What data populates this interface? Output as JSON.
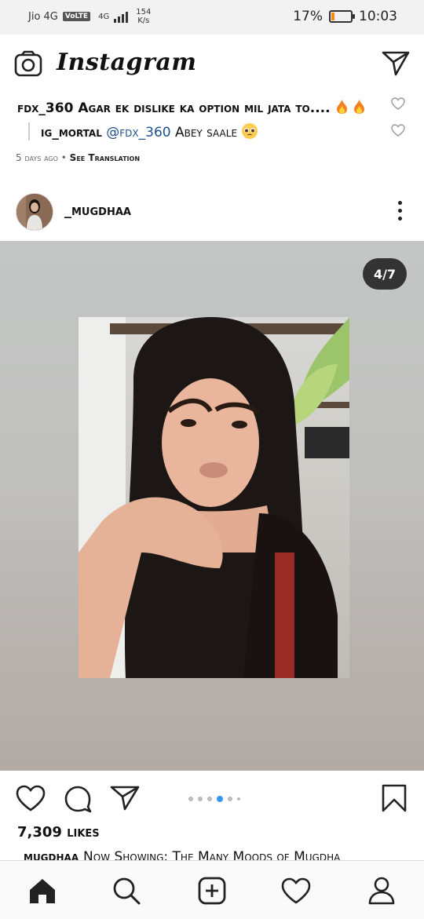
{
  "status_bar": {
    "carrier": "Jio 4G",
    "volte": "VoLTE",
    "network_type": "4G",
    "speed_value": "154",
    "speed_unit": "K/s",
    "battery_percent": "17%",
    "battery_level": 0.17,
    "battery_color": "#f28c16",
    "time": "10:03"
  },
  "app_bar": {
    "title": "Instagram",
    "left_icon": "camera-icon",
    "right_icon": "direct-send-icon"
  },
  "comments": [
    {
      "username": "fdx_360",
      "text": "Agar ek dislike ka option mil jata to....",
      "emoji": "fire fire"
    },
    {
      "username": "ig_mortal",
      "mention": "@fdx_360",
      "text": "Abey saale",
      "emoji": "pleading-face"
    }
  ],
  "comment_meta": {
    "time_ago": "5 days ago",
    "separator": "•",
    "translate": "See Translation"
  },
  "post": {
    "username": "_mugdhaa",
    "counter": "4/7",
    "current_index": 4,
    "total": 7,
    "likes": "7,309 likes",
    "caption_user": "mugdhaa",
    "caption_text": "Now Showing: The Many Moods of Mugdha"
  },
  "bottom_nav": [
    "home-icon",
    "search-icon",
    "new-post-icon",
    "activity-icon",
    "profile-icon"
  ]
}
